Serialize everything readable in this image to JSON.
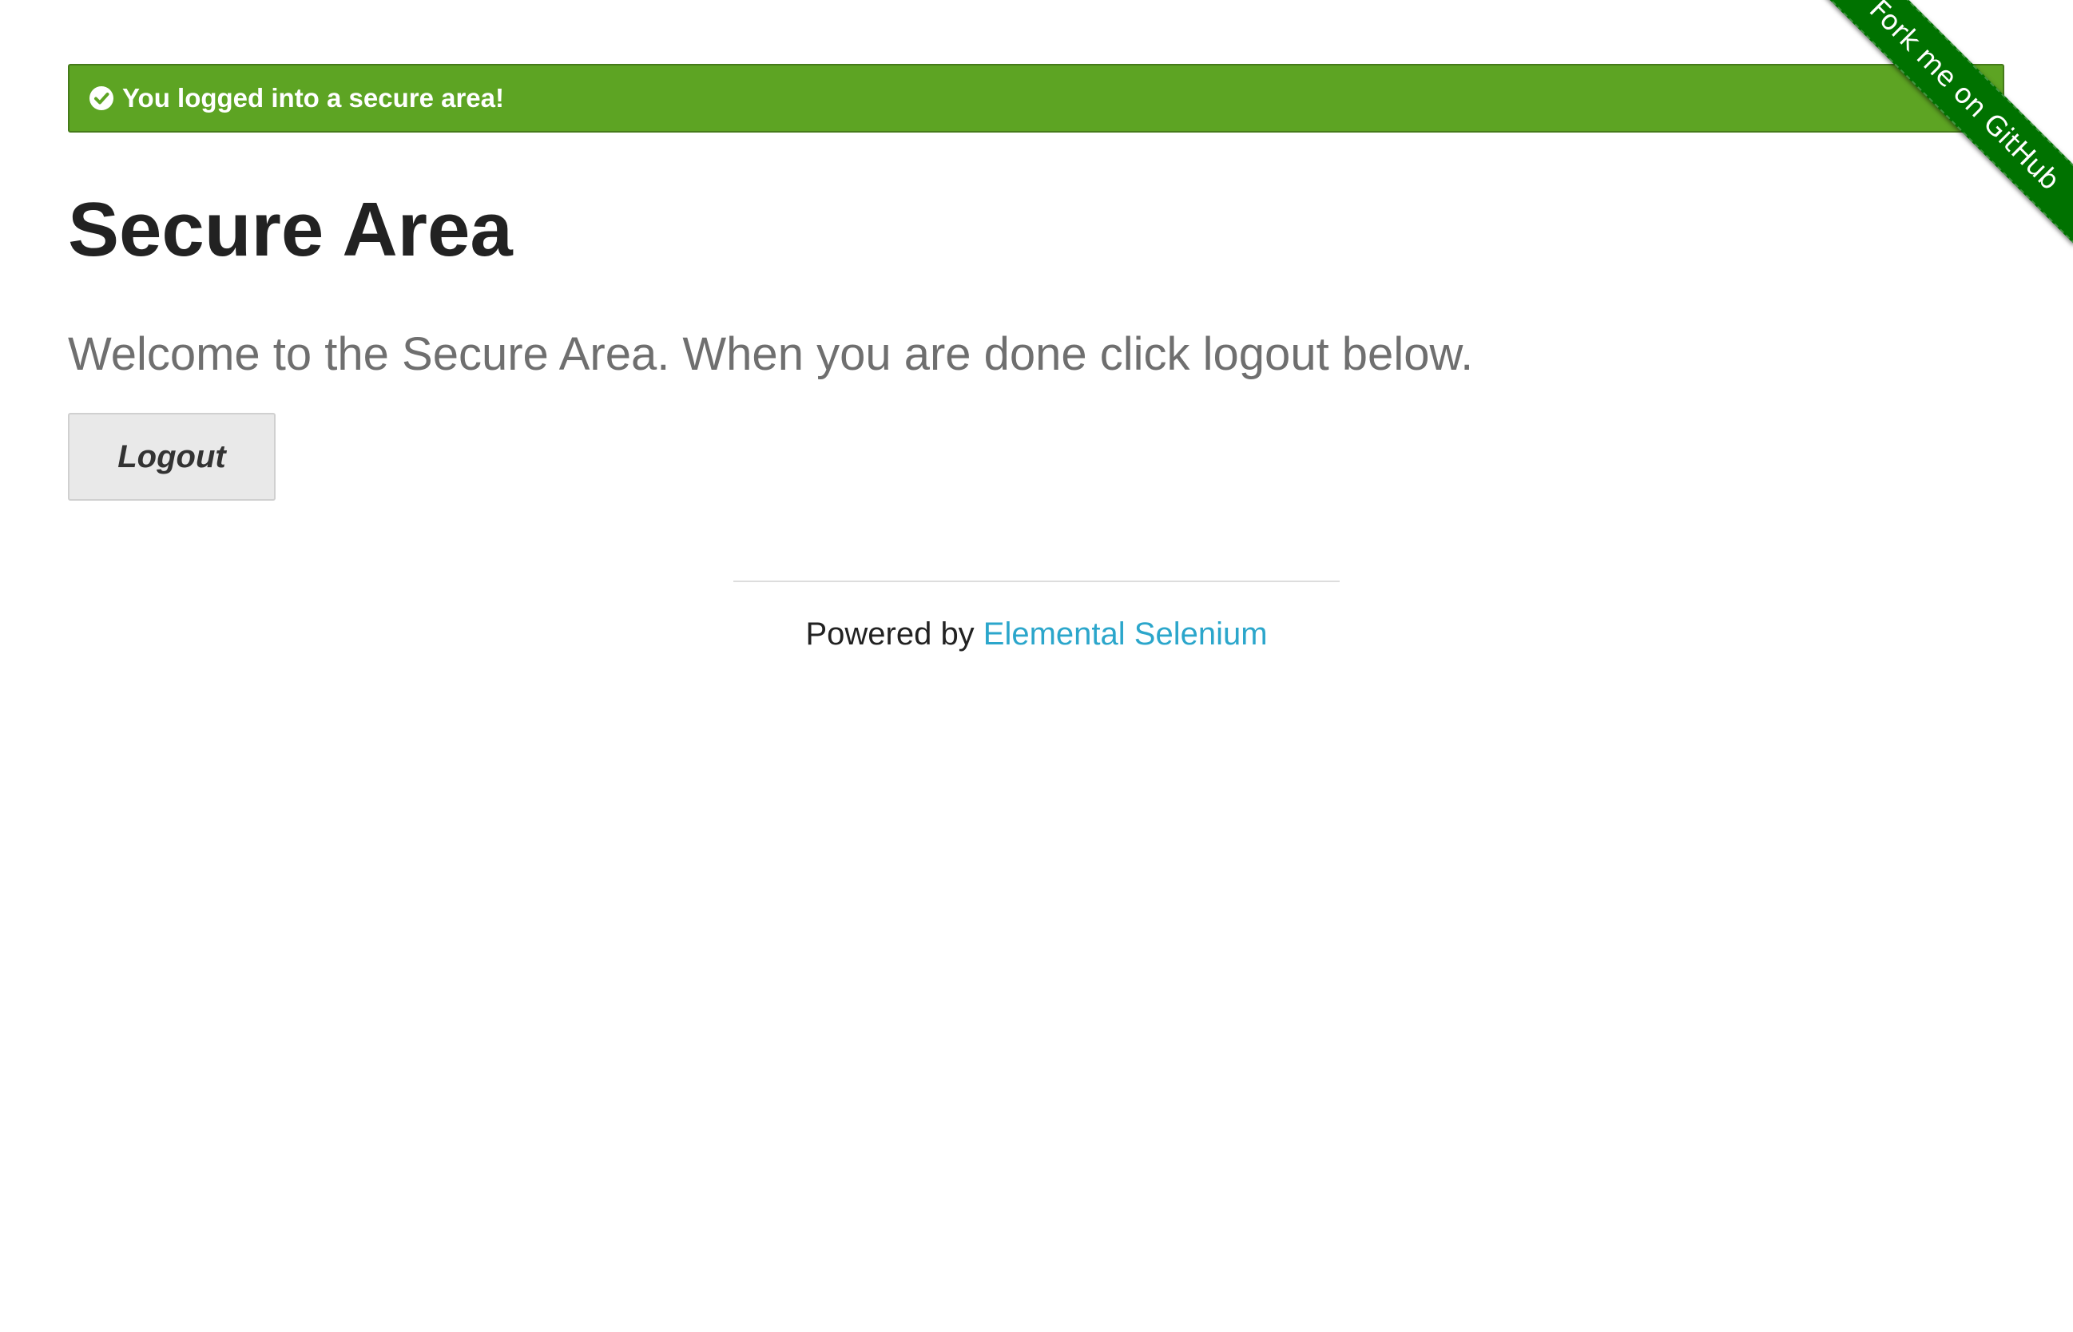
{
  "flash": {
    "message": "You logged into a secure area!",
    "close_glyph": "×",
    "icon": "check-circle-icon",
    "color": "#5da423"
  },
  "page": {
    "title": "Secure Area",
    "subheader": "Welcome to the Secure Area. When you are done click logout below."
  },
  "logout_button": {
    "label": "Logout",
    "icon": "sign-out-icon"
  },
  "footer": {
    "prefix": "Powered by ",
    "link_text": "Elemental Selenium",
    "link_color": "#2ba6cb"
  },
  "ribbon": {
    "label": "Fork me on GitHub",
    "color": "#007200"
  }
}
